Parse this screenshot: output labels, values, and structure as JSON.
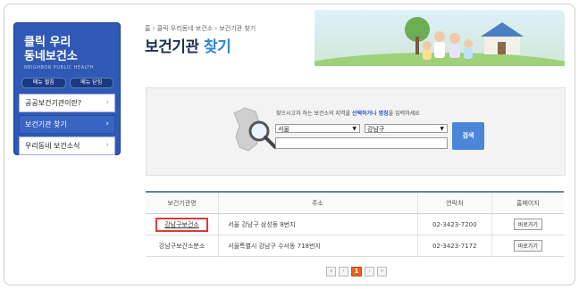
{
  "sidebar": {
    "title_line1": "클릭 우리",
    "title_line2": "동네보건소",
    "subtitle": "NEIGHBOR PUBLIC HEALTH",
    "pill_1": "메뉴 펼침",
    "pill_2": "메뉴 닫힘",
    "items": [
      {
        "label": "공공보건기관이란?"
      },
      {
        "label": "보건기관 찾기"
      },
      {
        "label": "우리동네 보건소식"
      }
    ]
  },
  "breadcrumb": "홈 › 클릭 우리동네 보건소 › 보건기관 찾기",
  "page_title": {
    "part1": "보건기관 ",
    "part2": "찾기"
  },
  "search": {
    "msg_prefix": "찾으시고자 하는 보건소의 지역을 ",
    "msg_highlight": "선택하거나 명칭",
    "msg_suffix": "을 입력하세요",
    "city_value": "서울",
    "district_value": "강남구",
    "text_value": "",
    "button_label": "검색"
  },
  "table": {
    "headers": [
      "보건기관명",
      "주소",
      "연락처",
      "홈페이지"
    ],
    "rows": [
      {
        "name": "강남구보건소",
        "address": "서울 강남구 삼성동 8번지",
        "tel": "02-3423-7200",
        "home": "바로가기"
      },
      {
        "name": "강남구보건소분소",
        "address": "서울특별시 강남구 수서동 718번지",
        "tel": "02-3423-7172",
        "home": "바로가기"
      }
    ]
  },
  "pagination": {
    "first": "«",
    "prev": "‹",
    "current": "1",
    "next": "›",
    "last": "»"
  },
  "colors": {
    "accent": "#2f59b5",
    "highlight_box": "#d83a3a",
    "current_page": "#e8621f"
  }
}
